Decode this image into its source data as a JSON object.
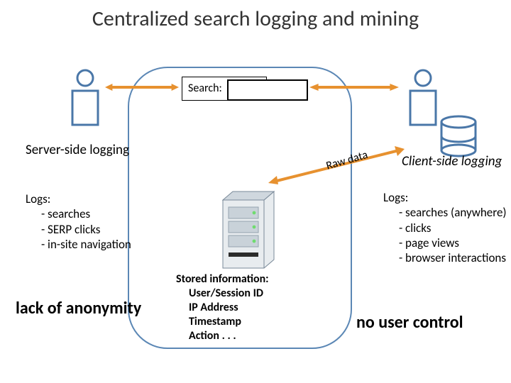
{
  "title": "Centralized search logging and mining",
  "search": {
    "label": "Search:"
  },
  "raw_data_label": "Raw data",
  "left": {
    "heading": "Server-side logging",
    "logs_label": "Logs:",
    "items": [
      "- searches",
      "- SERP clicks",
      "- in-site navigation"
    ],
    "drawback": "lack of anonymity"
  },
  "right": {
    "heading": "Client-side logging",
    "logs_label": "Logs:",
    "items": [
      "- searches (anywhere)",
      "- clicks",
      "- page views",
      "- browser interactions"
    ],
    "drawback": "no user control"
  },
  "stored": {
    "heading": "Stored information:",
    "items": [
      "User/Session ID",
      "IP Address",
      "Timestamp",
      "Action . . ."
    ]
  }
}
